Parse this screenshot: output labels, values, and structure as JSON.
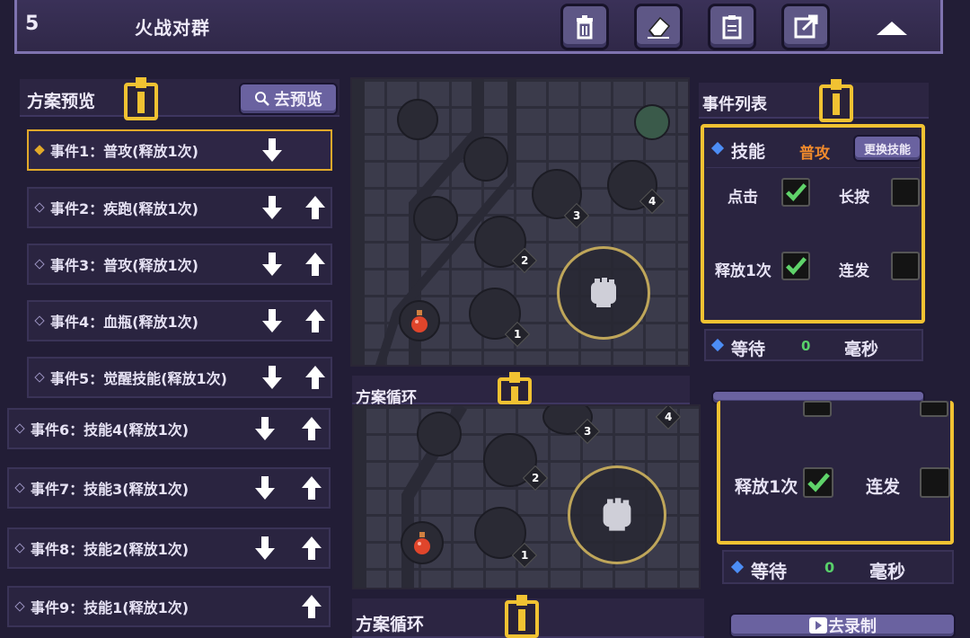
{
  "header": {
    "number": "5",
    "title": "火战对群",
    "buttons": [
      "trash-icon",
      "eraser-icon",
      "clipboard-icon",
      "export-icon"
    ]
  },
  "scheme_preview": {
    "title": "方案预览",
    "preview_button": "去预览",
    "events": [
      {
        "label": "事件1：普攻(释放1次)",
        "down": true,
        "up": false,
        "selected": true
      },
      {
        "label": "事件2：疾跑(释放1次)",
        "down": true,
        "up": true
      },
      {
        "label": "事件3：普攻(释放1次)",
        "down": true,
        "up": true
      },
      {
        "label": "事件4：血瓶(释放1次)",
        "down": true,
        "up": true
      },
      {
        "label": "事件5：觉醒技能(释放1次)",
        "down": true,
        "up": true
      },
      {
        "label": "事件6：技能4(释放1次)",
        "down": true,
        "up": true
      },
      {
        "label": "事件7：技能3(释放1次)",
        "down": true,
        "up": true
      },
      {
        "label": "事件8：技能2(释放1次)",
        "down": true,
        "up": true
      },
      {
        "label": "事件9：技能1(释放1次)",
        "down": false,
        "up": true
      }
    ]
  },
  "map": {
    "node_numbers": [
      "1",
      "2",
      "3",
      "4"
    ]
  },
  "event_list": {
    "title": "事件列表",
    "skill_label": "技能",
    "skill_value": "普攻",
    "change_skill_button": "更换技能",
    "click_label": "点击",
    "click_checked": true,
    "long_press_label": "长按",
    "long_press_checked": false,
    "release_once_label": "释放1次",
    "release_once_checked": true,
    "burst_label": "连发",
    "burst_checked": false,
    "wait_label": "等待",
    "wait_value": "0",
    "wait_unit": "毫秒"
  },
  "scheme_loop": {
    "title": "方案循环"
  },
  "record_button": "去录制",
  "colors": {
    "accent_gold": "#f1c232",
    "skill_orange": "#f08a2c",
    "check_green": "#5fd36a",
    "wait_green": "#58d06a"
  }
}
